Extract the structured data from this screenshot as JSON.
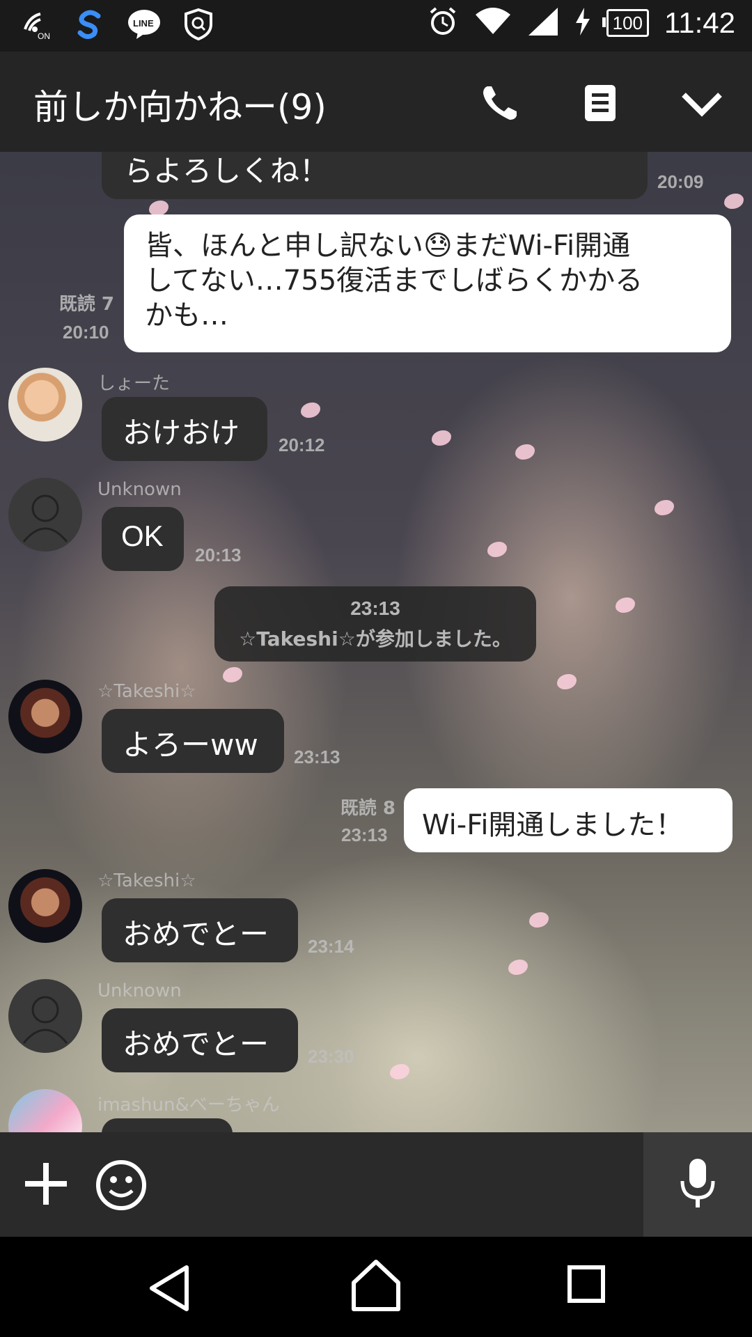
{
  "status_bar": {
    "time": "11:42",
    "battery": "100",
    "left_icons": [
      "nfc-on-icon",
      "s-app-icon",
      "line-icon",
      "shield-icon"
    ],
    "right_icons": [
      "alarm-icon",
      "wifi-icon",
      "signal-icon",
      "charging-icon"
    ]
  },
  "header": {
    "title": "前しか向かねー(9)",
    "actions": [
      "phone-icon",
      "notes-icon",
      "chevron-down-icon"
    ]
  },
  "messages": [
    {
      "type": "in",
      "text": "らよろしくね！",
      "time": "20:09"
    },
    {
      "type": "out",
      "lines": [
        "皆、ほんと申し訳ない😓まだWi-Fi開通",
        "してない…755復活までしばらくかかる",
        "かも…"
      ],
      "read": "既読 7",
      "time": "20:10"
    },
    {
      "type": "in",
      "sender": "しょーた",
      "text": "おけおけ",
      "time": "20:12"
    },
    {
      "type": "in",
      "sender": "Unknown",
      "text": "OK",
      "time": "20:13"
    },
    {
      "type": "system",
      "time": "23:13",
      "text": "☆Takeshi☆が参加しました。"
    },
    {
      "type": "in",
      "sender": "☆Takeshi☆",
      "text": "よろーww",
      "time": "23:13"
    },
    {
      "type": "out",
      "text": "Wi-Fi開通しました！",
      "read": "既読 8",
      "time": "23:13"
    },
    {
      "type": "in",
      "sender": "☆Takeshi☆",
      "text": "おめでとー",
      "time": "23:14"
    },
    {
      "type": "in",
      "sender": "Unknown",
      "text": "おめでとー",
      "time": "23:30"
    },
    {
      "type": "in",
      "sender": "imashun&べーちゃん",
      "text": ""
    }
  ],
  "input_bar": {
    "buttons": [
      "plus-icon",
      "emoji-icon",
      "mic-icon"
    ]
  },
  "nav_bar": {
    "buttons": [
      "back-icon",
      "home-icon",
      "recents-icon"
    ]
  },
  "colors": {
    "incoming_bubble": "#2f2f2f",
    "outgoing_bubble": "#ffffff",
    "header": "#252525"
  }
}
